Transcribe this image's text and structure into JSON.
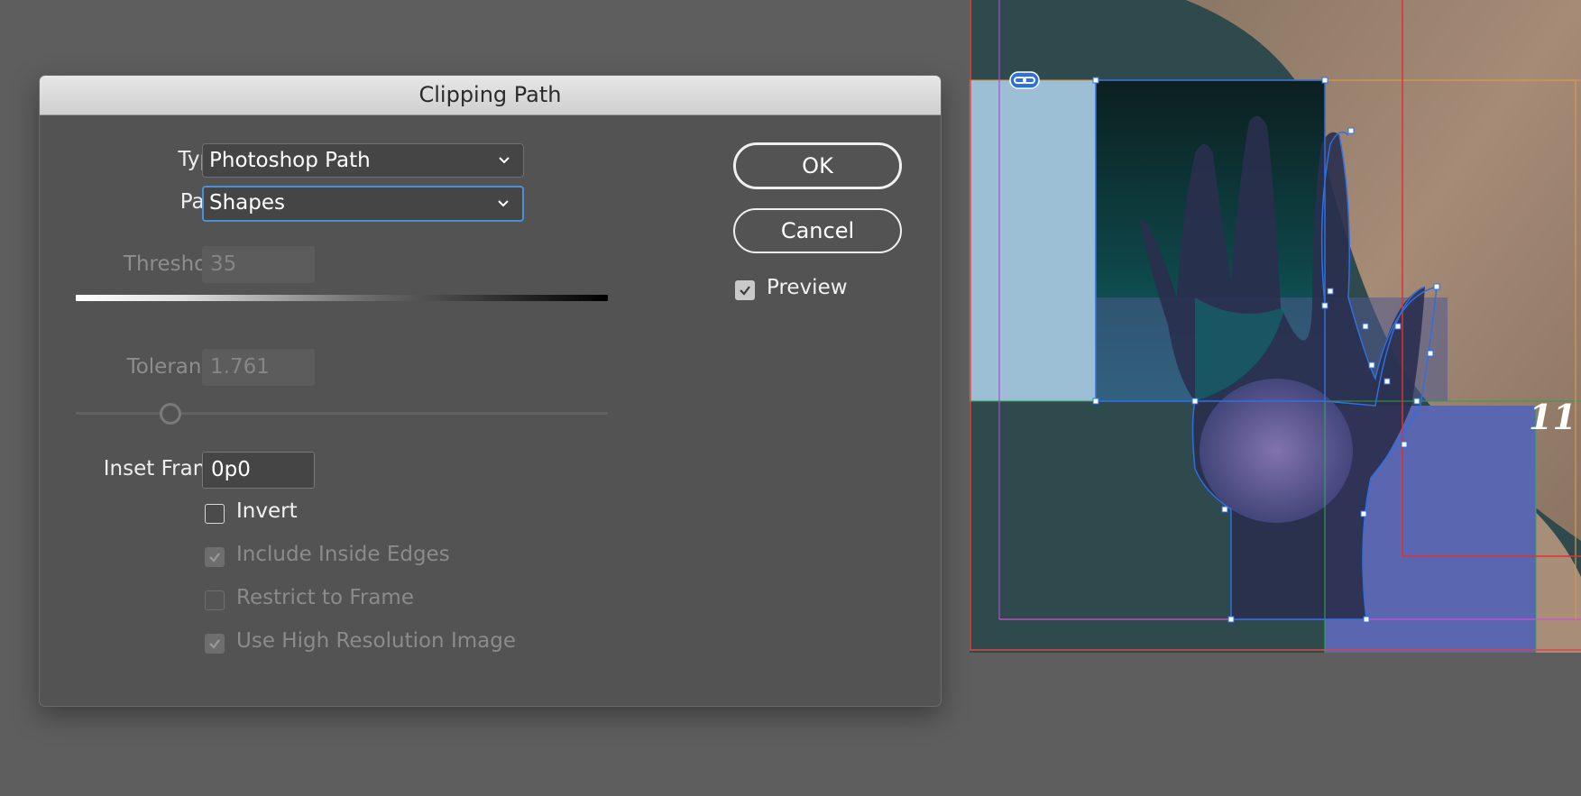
{
  "dialog": {
    "title": "Clipping Path",
    "type": {
      "label": "Type:",
      "value": "Photoshop Path"
    },
    "path": {
      "label": "Path:",
      "value": "Shapes"
    },
    "threshold": {
      "label": "Threshold:",
      "value": "35"
    },
    "tolerance": {
      "label": "Tolerance:",
      "value": "1.761"
    },
    "inset_frame": {
      "label": "Inset Frame:",
      "value": "0p0"
    },
    "checkboxes": {
      "invert": {
        "label": "Invert",
        "checked": false
      },
      "include_inside_edges": {
        "label": "Include Inside Edges",
        "checked": true
      },
      "restrict_to_frame": {
        "label": "Restrict to Frame",
        "checked": false
      },
      "use_high_res": {
        "label": "Use High Resolution Image",
        "checked": true
      }
    },
    "buttons": {
      "ok": "OK",
      "cancel": "Cancel"
    },
    "preview": {
      "label": "Preview",
      "checked": true
    }
  },
  "canvas": {
    "page_number": "11",
    "icons": {
      "link": "link-icon"
    }
  },
  "colors": {
    "focus_ring": "#4a90d9",
    "selection_blue": "#2f6fe0",
    "frame_light_blue": "#9dbfd6",
    "frame_violet": "#5a66b0"
  }
}
